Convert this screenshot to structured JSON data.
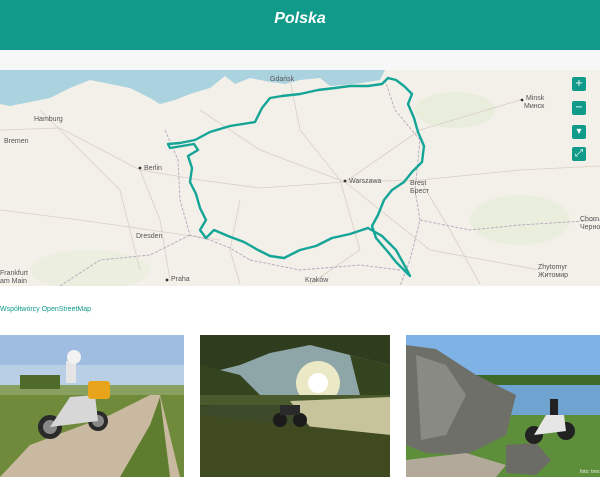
{
  "header": {
    "title": "Polska"
  },
  "map": {
    "cities": [
      {
        "id": "gdansk",
        "label": "Gdańsk"
      },
      {
        "id": "minsk",
        "label": "Minsk"
      },
      {
        "id": "minsk_cy",
        "label": "Минск"
      },
      {
        "id": "hamburg",
        "label": "Hamburg"
      },
      {
        "id": "bremen",
        "label": "Bremen"
      },
      {
        "id": "berlin",
        "label": "Berlin"
      },
      {
        "id": "warszawa",
        "label": "Warszawa"
      },
      {
        "id": "brest",
        "label": "Brest"
      },
      {
        "id": "brest_cy",
        "label": "Брест"
      },
      {
        "id": "dresden",
        "label": "Dresden"
      },
      {
        "id": "frankfurt",
        "label": "Frankfurt"
      },
      {
        "id": "frankfurt2",
        "label": "am Main"
      },
      {
        "id": "praha",
        "label": "Praha"
      },
      {
        "id": "krakow",
        "label": "Kraków"
      },
      {
        "id": "zhytomyr",
        "label": "Zhytomyr"
      },
      {
        "id": "zhytomyr_cy",
        "label": "Житомир"
      },
      {
        "id": "chorn",
        "label": "Chorn"
      },
      {
        "id": "chorn_cy",
        "label": "Черно"
      }
    ],
    "controls": {
      "zoom_in": "+",
      "zoom_out": "−",
      "locate": "▾",
      "fullscreen": "⤢"
    },
    "route_color": "#14a597",
    "attribution": "Współtwórcy OpenStreetMap"
  },
  "gallery": {
    "photo_credit": "foto: tres"
  },
  "colors": {
    "accent": "#0f9a8a"
  }
}
